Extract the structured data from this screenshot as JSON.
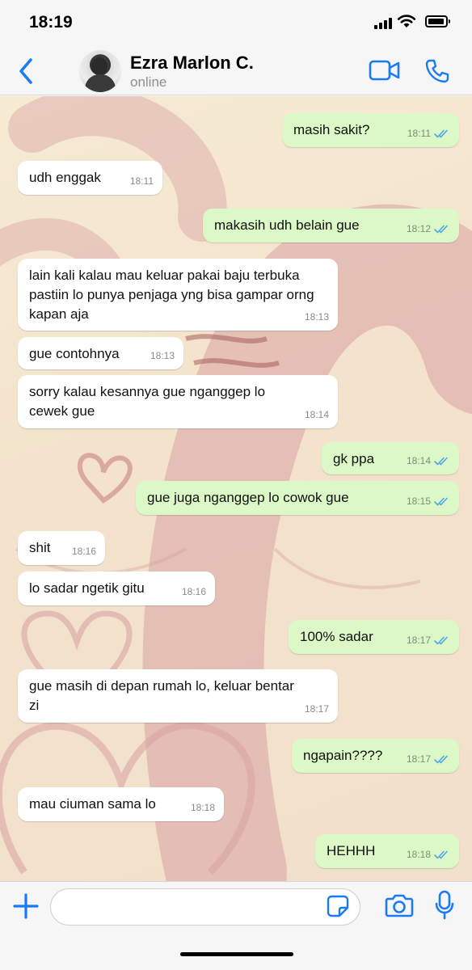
{
  "status_bar": {
    "time": "18:19"
  },
  "header": {
    "contact_name": "Ezra Marlon C.",
    "contact_status": "online"
  },
  "colors": {
    "accent": "#1a7af8",
    "outgoing_bubble": "#dcf8c6",
    "incoming_bubble": "#ffffff",
    "read_ticks": "#4fa6e6"
  },
  "messages": [
    {
      "text": "masih sakit?",
      "time": "18:11",
      "direction": "out",
      "read": true
    },
    {
      "text": "udh enggak",
      "time": "18:11",
      "direction": "in"
    },
    {
      "text": "makasih udh belain gue",
      "time": "18:12",
      "direction": "out",
      "read": true
    },
    {
      "text": "lain kali kalau mau keluar pakai baju terbuka pastiin lo punya penjaga yng bisa gampar orng kapan aja",
      "time": "18:13",
      "direction": "in"
    },
    {
      "text": "gue contohnya",
      "time": "18:13",
      "direction": "in"
    },
    {
      "text": "sorry kalau kesannya gue nganggep lo cewek gue",
      "time": "18:14",
      "direction": "in"
    },
    {
      "text": "gk ppa",
      "time": "18:14",
      "direction": "out",
      "read": true
    },
    {
      "text": "gue juga nganggep lo cowok gue",
      "time": "18:15",
      "direction": "out",
      "read": true
    },
    {
      "text": "shit",
      "time": "18:16",
      "direction": "in"
    },
    {
      "text": "lo sadar ngetik gitu",
      "time": "18:16",
      "direction": "in"
    },
    {
      "text": "100% sadar",
      "time": "18:17",
      "direction": "out",
      "read": true
    },
    {
      "text": "gue masih di depan rumah lo, keluar bentar zi",
      "time": "18:17",
      "direction": "in"
    },
    {
      "text": "ngapain????",
      "time": "18:17",
      "direction": "out",
      "read": true
    },
    {
      "text": "mau ciuman sama lo",
      "time": "18:18",
      "direction": "in"
    },
    {
      "text": "HEHHH",
      "time": "18:18",
      "direction": "out",
      "read": true
    }
  ],
  "input": {
    "placeholder": "",
    "value": ""
  },
  "icons": {
    "back": "chevron-left-icon",
    "video": "video-camera-icon",
    "call": "phone-icon",
    "plus": "plus-icon",
    "sticker": "sticker-icon",
    "camera": "camera-icon",
    "mic": "microphone-icon"
  }
}
